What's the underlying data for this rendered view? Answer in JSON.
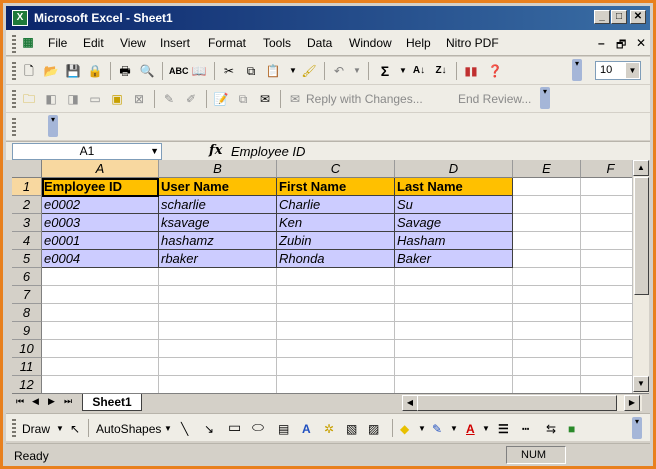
{
  "window": {
    "title": "Microsoft Excel - Sheet1",
    "icon": "excel-icon",
    "minimize_glyph": "_",
    "maximize_glyph": "□",
    "close_glyph": "✕"
  },
  "menubar": {
    "items": [
      "File",
      "Edit",
      "View",
      "Insert",
      "Format",
      "Tools",
      "Data",
      "Window",
      "Help",
      "Nitro PDF"
    ],
    "doc_minimize": "–",
    "doc_restore": "🗗",
    "doc_close": "✕"
  },
  "toolbar": {
    "sigma": "Σ",
    "font_size": "10"
  },
  "reviewing": {
    "reply_with_changes": "Reply with Changes...",
    "end_review": "End Review..."
  },
  "formula_bar": {
    "name_box": "A1",
    "fx_label": "fx",
    "value": "Employee ID"
  },
  "grid": {
    "columns": [
      "A",
      "B",
      "C",
      "D",
      "E",
      "F"
    ],
    "rows": [
      "1",
      "2",
      "3",
      "4",
      "5",
      "6",
      "7",
      "8",
      "9",
      "10",
      "11",
      "12"
    ],
    "header": [
      "Employee ID",
      "User Name",
      "First Name",
      "Last Name"
    ],
    "data": [
      [
        "e0002",
        "scharlie",
        "Charlie",
        "Su"
      ],
      [
        "e0003",
        "ksavage",
        "Ken",
        "Savage"
      ],
      [
        "e0001",
        "hashamz",
        "Zubin",
        "Hasham"
      ],
      [
        "e0004",
        "rbaker",
        "Rhonda",
        "Baker"
      ]
    ],
    "active_cell": "A1",
    "colors": {
      "header_fill": "#ffc000",
      "data_fill": "#ccccff"
    }
  },
  "sheet_tabs": {
    "active": "Sheet1"
  },
  "drawing": {
    "draw_label": "Draw",
    "autoshapes_label": "AutoShapes"
  },
  "status": {
    "mode": "Ready",
    "num": "NUM"
  }
}
